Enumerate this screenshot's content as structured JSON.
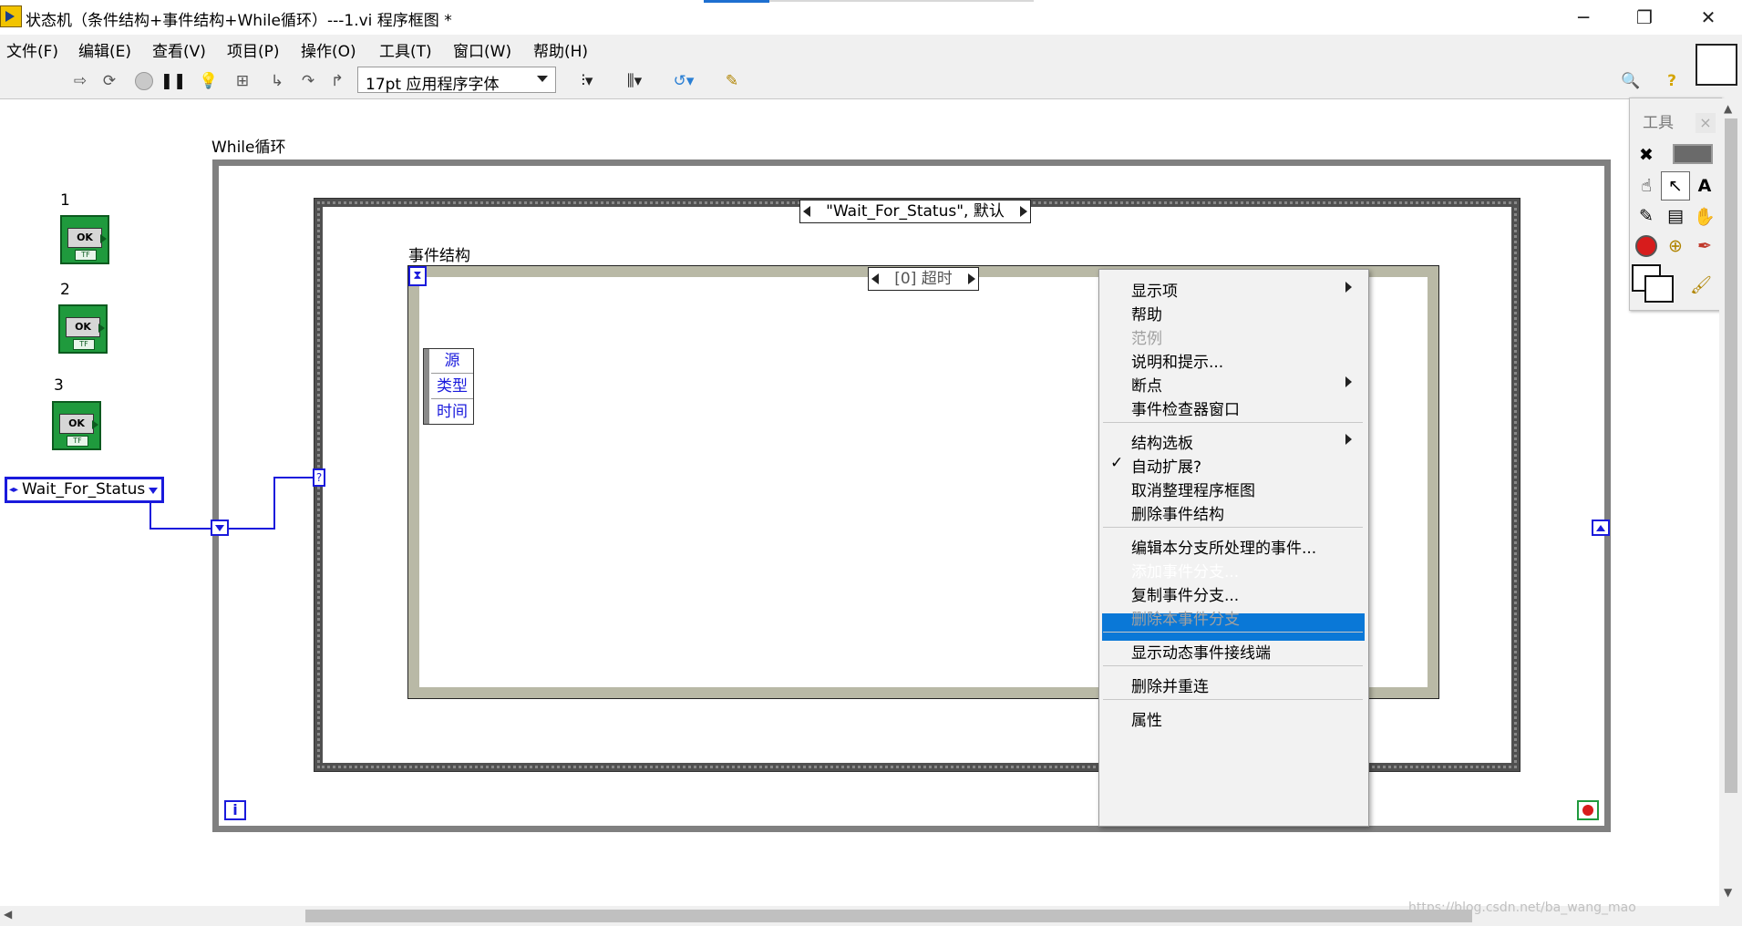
{
  "window": {
    "title": "状态机（条件结构+事件结构+While循环）---1.vi 程序框图 *",
    "minimize": "─",
    "restore": "❐",
    "close": "✕"
  },
  "menu": [
    "文件(F)",
    "编辑(E)",
    "查看(V)",
    "项目(P)",
    "操作(O)",
    "工具(T)",
    "窗口(W)",
    "帮助(H)"
  ],
  "toolbar": {
    "font_select": "17pt 应用程序字体",
    "icons": [
      "run-arrow-icon",
      "run-continuously-icon",
      "abort-icon",
      "pause-icon",
      "highlight-bulb-icon",
      "retain-wire-values-icon",
      "step-into-icon",
      "step-over-icon",
      "step-out-icon",
      "align-icon",
      "distribute-icon",
      "reorder-icon",
      "cleanup-icon",
      "search-icon",
      "help-icon"
    ]
  },
  "diagram": {
    "while_label": "While循环",
    "bool_controls": [
      {
        "label": "1",
        "text": "OK",
        "tf": "TF"
      },
      {
        "label": "2",
        "text": "OK",
        "tf": "TF"
      },
      {
        "label": "3",
        "text": "OK",
        "tf": "TF"
      }
    ],
    "enum_const": "Wait_For_Status",
    "case_selector": "\"Wait_For_Status\", 默认",
    "event_label": "事件结构",
    "event_selector": "[0] 超时",
    "event_data": [
      "源",
      "类型",
      "时间"
    ],
    "iteration_terminal": "i",
    "case_terminal": "?"
  },
  "tools_palette": {
    "title": "工具",
    "close": "×",
    "tools": [
      "auto-tool-icon",
      "auto-indicator-icon",
      "operate-hand-icon",
      "position-arrow-icon",
      "label-text-icon",
      "wiring-spool-icon",
      "shortcut-menu-icon",
      "scroll-hand-icon",
      "breakpoint-icon",
      "probe-icon",
      "color-copy-icon",
      "color-palette-icon",
      "paint-brush-icon"
    ]
  },
  "context_menu": {
    "items": [
      {
        "label": "显示项",
        "submenu": true,
        "disabled": false
      },
      {
        "label": "帮助",
        "submenu": false,
        "disabled": false
      },
      {
        "label": "范例",
        "submenu": false,
        "disabled": true
      },
      {
        "label": "说明和提示...",
        "submenu": false,
        "disabled": false
      },
      {
        "label": "断点",
        "submenu": true,
        "disabled": false
      },
      {
        "label": "事件检查器窗口",
        "submenu": false,
        "disabled": false
      },
      {
        "label": "结构选板",
        "submenu": true,
        "disabled": false
      },
      {
        "label": "自动扩展?",
        "submenu": false,
        "disabled": false,
        "checked": true
      },
      {
        "label": "取消整理程序框图",
        "submenu": false,
        "disabled": false
      },
      {
        "label": "删除事件结构",
        "submenu": false,
        "disabled": false
      },
      {
        "label": "编辑本分支所处理的事件...",
        "submenu": false,
        "disabled": false
      },
      {
        "label": "添加事件分支...",
        "submenu": false,
        "disabled": false,
        "highlighted": true
      },
      {
        "label": "复制事件分支...",
        "submenu": false,
        "disabled": false
      },
      {
        "label": "删除本事件分支",
        "submenu": false,
        "disabled": true
      },
      {
        "label": "显示动态事件接线端",
        "submenu": false,
        "disabled": false
      },
      {
        "label": "删除并重连",
        "submenu": false,
        "disabled": false
      },
      {
        "label": "属性",
        "submenu": false,
        "disabled": false
      }
    ],
    "check_mark": "✓"
  },
  "watermark": "https://blog.csdn.net/ba_wang_mao",
  "colors": {
    "wire_blue": "#1a1adc",
    "bool_green": "#1f9a3d",
    "highlight": "#0a78d7"
  }
}
